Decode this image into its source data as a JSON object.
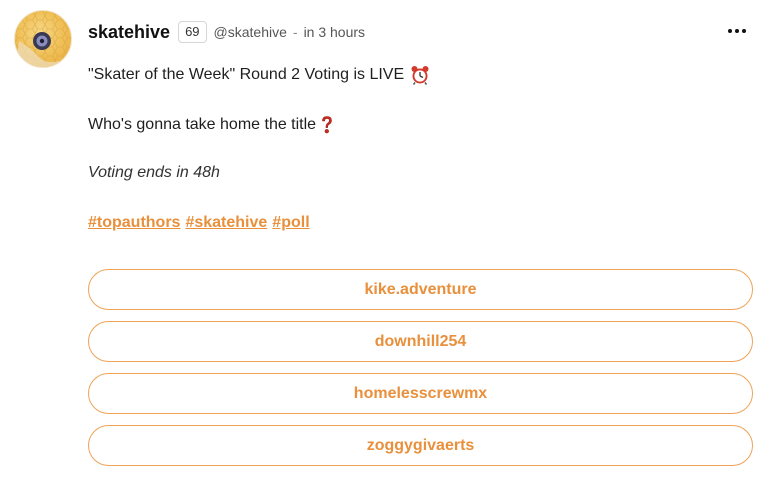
{
  "post": {
    "author": "skatehive",
    "reputation": "69",
    "handle": "@skatehive",
    "separator": "-",
    "time": "in 3 hours",
    "title": "\"Skater of the Week\" Round 2 Voting is LIVE",
    "question": "Who's gonna take home the title",
    "note": "Voting ends in 48h",
    "tags": [
      "#topauthors",
      "#skatehive",
      "#poll"
    ]
  },
  "poll": {
    "options": [
      "kike.adventure",
      "downhill254",
      "homelesscrewmx",
      "zoggygivaerts"
    ]
  },
  "icons": {
    "avatar": "skatehive-logo-avatar",
    "menu": "more-options-icon",
    "title_emoji": "alarm-clock-icon",
    "question_emoji": "red-question-mark-icon"
  },
  "colors": {
    "accent": "#e8903c",
    "option_border": "#eea35a",
    "text": "#1f1f1f"
  }
}
